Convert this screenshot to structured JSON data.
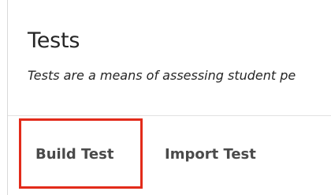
{
  "page": {
    "title": "Tests",
    "description": "Tests are a means of assessing student pe"
  },
  "toolbar": {
    "build_label": "Build Test",
    "import_label": "Import Test"
  },
  "colors": {
    "highlight": "#e22b1a",
    "text": "#262626",
    "button_text": "#4a4a4a"
  }
}
